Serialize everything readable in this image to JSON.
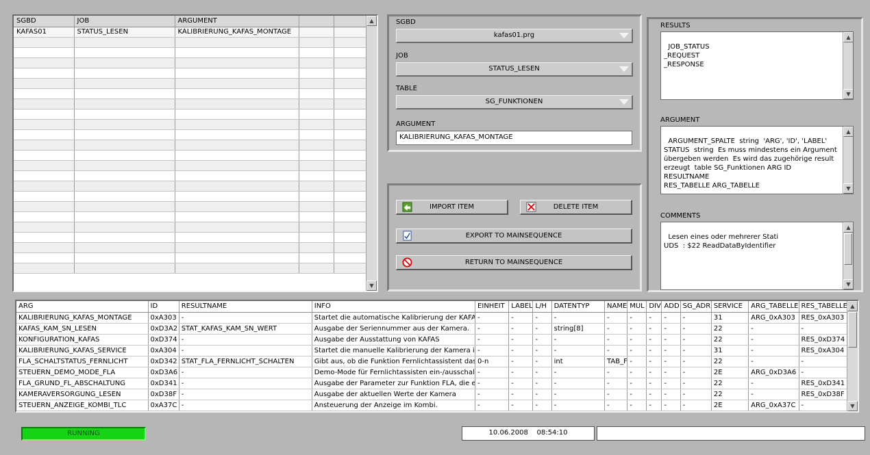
{
  "top_grid": {
    "columns": [
      "SGBD",
      "JOB",
      "ARGUMENT",
      "",
      ""
    ],
    "rows": [
      [
        "KAFAS01",
        "STATUS_LESEN",
        "KALIBRIERUNG_KAFAS_MONTAGE",
        "",
        ""
      ]
    ]
  },
  "config": {
    "sgbd_label": "SGBD",
    "sgbd_value": "kafas01.prg",
    "job_label": "JOB",
    "job_value": "STATUS_LESEN",
    "table_label": "TABLE",
    "table_value": "SG_FUNKTIONEN",
    "argument_label": "ARGUMENT",
    "argument_value": "KALIBRIERUNG_KAFAS_MONTAGE"
  },
  "actions": {
    "import_label": "IMPORT ITEM",
    "delete_label": "DELETE ITEM",
    "export_label": "EXPORT TO MAINSEQUENCE",
    "return_label": "RETURN TO MAINSEQUENCE"
  },
  "info": {
    "results_label": "RESULTS",
    "results_text": "JOB_STATUS\n_REQUEST\n_RESPONSE",
    "argument_label": "ARGUMENT",
    "argument_text": "ARGUMENT_SPALTE  string  'ARG', 'ID', 'LABEL'\nSTATUS  string  Es muss mindestens ein Argument\nübergeben werden  Es wird das zugehörige result\nerzeugt  table SG_Funktionen ARG ID RESULTNAME\nRES_TABELLE ARG_TABELLE",
    "comments_label": "COMMENTS",
    "comments_text": "Lesen eines oder mehrerer Stati\nUDS  : $22 ReadDataByIdentifier"
  },
  "bottom_table": {
    "columns": [
      "ARG",
      "ID",
      "RESULTNAME",
      "INFO",
      "EINHEIT",
      "LABEL",
      "L/H",
      "DATENTYP",
      "NAME",
      "MUL",
      "DIV",
      "ADD",
      "SG_ADR",
      "SERVICE",
      "ARG_TABELLE",
      "RES_TABELLE"
    ],
    "rows": [
      [
        "KALIBRIERUNG_KAFAS_MONTAGE",
        "0xA303",
        "-",
        "Startet die automatische Kalibrierung der KAFAS",
        "-",
        "-",
        "-",
        "-",
        "-",
        "-",
        "-",
        "-",
        "-",
        "31",
        "ARG_0xA303",
        "RES_0xA303"
      ],
      [
        "KAFAS_KAM_SN_LESEN",
        "0xD3A2",
        "STAT_KAFAS_KAM_SN_WERT",
        "Ausgabe der Seriennummer aus der Kamera.",
        "-",
        "-",
        "-",
        "string[8]",
        "-",
        "-",
        "-",
        "-",
        "-",
        "22",
        "-",
        "-"
      ],
      [
        "KONFIGURATION_KAFAS",
        "0xD374",
        "-",
        "Ausgabe der Ausstattung von KAFAS",
        "-",
        "-",
        "-",
        "-",
        "-",
        "-",
        "-",
        "-",
        "-",
        "22",
        "-",
        "RES_0xD374"
      ],
      [
        "KALIBRIERUNG_KAFAS_SERVICE",
        "0xA304",
        "-",
        "Startet die manuelle Kalibrierung der Kamera im :",
        "-",
        "-",
        "-",
        "-",
        "-",
        "-",
        "-",
        "-",
        "-",
        "31",
        "-",
        "RES_0xA304"
      ],
      [
        "FLA_SCHALTSTATUS_FERNLICHT",
        "0xD342",
        "STAT_FLA_FERNLICHT_SCHALTEN",
        "Gibt aus, ob die Funktion Fernlichtassistent das l",
        "0-n",
        "-",
        "-",
        "int",
        "TAB_F",
        "-",
        "-",
        "-",
        "-",
        "22",
        "-",
        "-"
      ],
      [
        "STEUERN_DEMO_MODE_FLA",
        "0xD3A6",
        "-",
        "Demo-Mode für Fernlichtassisten ein-/ausschalte",
        "-",
        "-",
        "-",
        "-",
        "-",
        "-",
        "-",
        "-",
        "-",
        "2E",
        "ARG_0xD3A6",
        "-"
      ],
      [
        "FLA_GRUND_FL_ABSCHALTUNG",
        "0xD341",
        "-",
        "Ausgabe der Parameter zur Funktion FLA, die eir",
        "-",
        "-",
        "-",
        "-",
        "-",
        "-",
        "-",
        "-",
        "-",
        "22",
        "-",
        "RES_0xD341"
      ],
      [
        "KAMERAVERSORGUNG_LESEN",
        "0xD38F",
        "-",
        "Ausgabe der aktuellen Werte der Kamera",
        "-",
        "-",
        "-",
        "-",
        "-",
        "-",
        "-",
        "-",
        "-",
        "22",
        "-",
        "RES_0xD38F"
      ],
      [
        "STEUERN_ANZEIGE_KOMBI_TLC",
        "0xA37C",
        "-",
        "Ansteuerung der Anzeige im Kombi.",
        "-",
        "-",
        "-",
        "-",
        "-",
        "-",
        "-",
        "-",
        "-",
        "2E",
        "ARG_0xA37C",
        "-"
      ]
    ]
  },
  "status": {
    "running_label": "RUNNING",
    "datetime": "10.06.2008    08:54:10",
    "message": ""
  },
  "colors": {
    "background": "#b6b6b6",
    "running": "#14d414"
  }
}
